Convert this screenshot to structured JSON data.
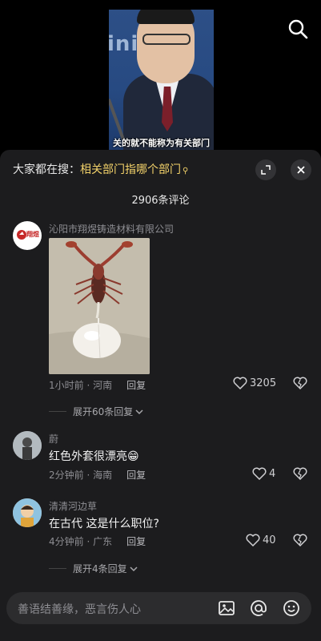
{
  "video": {
    "subtitle": "关的就不能称为有关部门"
  },
  "sheet": {
    "search_prefix": "大家都在搜：",
    "search_keyword": "相关部门指哪个部门",
    "comment_count": "2906条评论"
  },
  "comments": [
    {
      "avatar_text": "翔煜",
      "username": "沁阳市翔煜铸造材料有限公司",
      "text": "",
      "time_location": "1小时前 · 河南",
      "reply_label": "回复",
      "likes": "3205",
      "expand_label": "展开60条回复"
    },
    {
      "username": "蔚",
      "text": "红色外套很漂亮😁",
      "time_location": "2分钟前 · 海南",
      "reply_label": "回复",
      "likes": "4"
    },
    {
      "username": "清清河边草",
      "text": "在古代  这是什么职位?",
      "time_location": "4分钟前 · 广东",
      "reply_label": "回复",
      "likes": "40",
      "expand_label": "展开4条回复"
    }
  ],
  "input": {
    "placeholder": "善语结善缘，恶言伤人心"
  },
  "colors": {
    "sheet_bg": "#1c1c1e",
    "keyword": "#f3d26a",
    "secondary_text": "#8e8e93"
  }
}
